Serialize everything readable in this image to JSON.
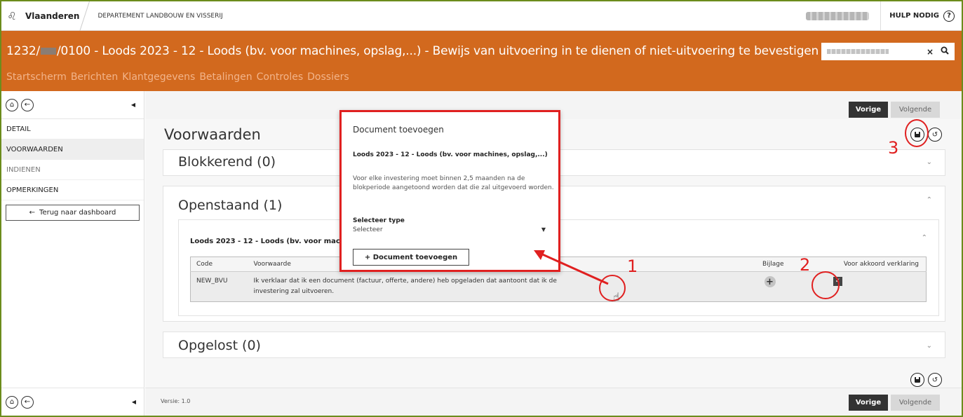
{
  "topbar": {
    "brand": "Vlaanderen",
    "department": "DEPARTEMENT LANDBOUW EN VISSERIJ",
    "help": "HULP NODIG",
    "help_icon": "?"
  },
  "header": {
    "title_prefix": "1232/",
    "title_suffix": "/0100 - Loods 2023 - 12 - Loods (bv. voor machines, opslag,...) - Bewijs van uitvoering in te dienen of niet-uitvoering te bevestigen",
    "nav": [
      "Startscherm",
      "Berichten",
      "Klantgegevens",
      "Betalingen",
      "Controles",
      "Dossiers"
    ],
    "search_clear": "×"
  },
  "sidebar": {
    "items": [
      {
        "label": "DETAIL",
        "state": "normal"
      },
      {
        "label": "VOORWAARDEN",
        "state": "active"
      },
      {
        "label": "INDIENEN",
        "state": "muted"
      },
      {
        "label": "OPMERKINGEN",
        "state": "normal"
      }
    ],
    "back_button": "Terug naar dashboard"
  },
  "main": {
    "prev_label": "Vorige",
    "next_label": "Volgende",
    "heading": "Voorwaarden",
    "blokkerend": "Blokkerend (0)",
    "openstaand": "Openstaand (1)",
    "opgelost": "Opgelost (0)",
    "inner_title": "Loods 2023 - 12 - Loods (bv. voor machin",
    "table": {
      "headers": [
        "Code",
        "Voorwaarde",
        "Bijlage",
        "Voor akkoord verklaring"
      ],
      "rows": [
        {
          "code": "NEW_BVU",
          "voorwaarde": "Ik verklaar dat ik een document (factuur, offerte, andere) heb opgeladen dat aantoont dat ik de investering zal uitvoeren.",
          "bijlage": "+",
          "akkoord": "✓"
        }
      ]
    },
    "version": "Versie: 1.0"
  },
  "popup": {
    "title": "Document toevoegen",
    "subtitle": "Loods 2023 - 12 - Loods (bv. voor machines, opslag,...)",
    "description": "Voor elke investering moet binnen 2,5 maanden na de blokperiode aangetoond worden dat die zal uitgevoerd worden.",
    "type_label": "Selecteer type",
    "type_value": "Selecteer",
    "add_button": "+ Document toevoegen"
  },
  "annotations": [
    "1",
    "2",
    "3"
  ],
  "colors": {
    "header_orange": "#d2691e",
    "nav_text": "#f2b48a",
    "annotation_red": "#e02020",
    "frame_green": "#6c8c1c"
  },
  "icons": [
    "lion-icon",
    "help-icon",
    "search-icon",
    "home-icon",
    "back-icon",
    "collapse-icon",
    "save-icon",
    "undo-icon",
    "chevron-down-icon",
    "chevron-up-icon",
    "plus-icon",
    "checkbox-icon",
    "cursor-icon",
    "arrow-left-icon"
  ]
}
